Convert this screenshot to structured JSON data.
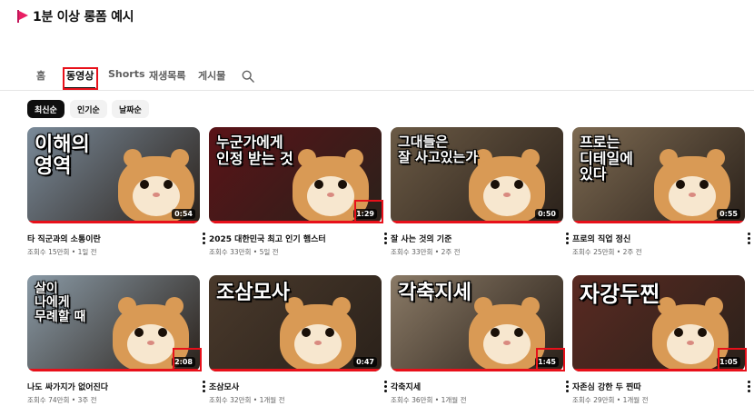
{
  "heading": "1분 이상 롱폼 예시",
  "tabs": [
    {
      "label": "홈",
      "active": false
    },
    {
      "label": "동영상",
      "active": true
    },
    {
      "label": "Shorts",
      "active": false
    },
    {
      "label": "재생목록",
      "active": false
    },
    {
      "label": "게시물",
      "active": false
    }
  ],
  "filters": [
    {
      "label": "최신순",
      "selected": true
    },
    {
      "label": "인기순",
      "selected": false
    },
    {
      "label": "날짜순",
      "selected": false
    }
  ],
  "videos": [
    {
      "title": "타 직군과의 소통이란",
      "meta": "조회수 15만회 • 1일 전",
      "duration": "0:54",
      "thumb_text": "이해의\n영역",
      "bg": "#7a8a99"
    },
    {
      "title": "2025 대한민국 최고 인기 햄스터",
      "meta": "조회수 33만회 • 5일 전",
      "duration": "1:29",
      "thumb_text": "누군가에게\n인정 받는 것",
      "bg": "#5a1318"
    },
    {
      "title": "잘 사는 것의 기준",
      "meta": "조회수 33만회 • 2주 전",
      "duration": "0:50",
      "thumb_text": "그대들은\n잘 사고있는가",
      "bg": "#6b5a45"
    },
    {
      "title": "프로의 직업 정신",
      "meta": "조회수 25만회 • 2주 전",
      "duration": "0:55",
      "thumb_text": "프로는\n디테일에\n있다",
      "bg": "#7d6a52"
    },
    {
      "title": "나도 싸가지가 없어진다",
      "meta": "조회수 74만회 • 3주 전",
      "duration": "2:08",
      "thumb_text": "살이\n나에게\n무례할 때",
      "bg": "#8a9aa6"
    },
    {
      "title": "조삼모사",
      "meta": "조회수 32만회 • 1개월 전",
      "duration": "0:47",
      "thumb_text": "조삼모사",
      "bg": "#4a3a2c"
    },
    {
      "title": "각축지세",
      "meta": "조회수 36만회 • 1개월 전",
      "duration": "1:45",
      "thumb_text": "각축지세",
      "bg": "#8a7a66"
    },
    {
      "title": "자존심 강한 두 찐따",
      "meta": "조회수 29만회 • 1개월 전",
      "duration": "1:05",
      "thumb_text": "자강두찐",
      "bg": "#5a2a22"
    }
  ],
  "colors": {
    "highlight": "#e8101a",
    "fur": "#d99a55",
    "accent": "#0f0f0f"
  }
}
